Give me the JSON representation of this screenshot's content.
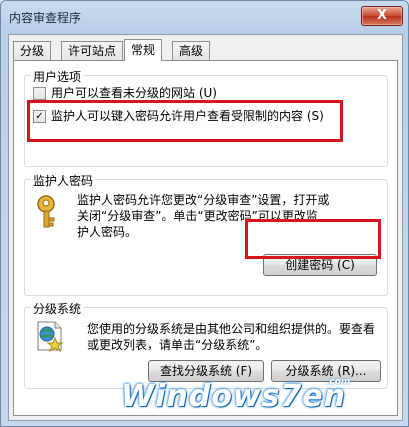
{
  "window": {
    "title": "内容审查程序",
    "close_label": "X"
  },
  "tabs": [
    {
      "label": "分级"
    },
    {
      "label": "许可站点"
    },
    {
      "label": "常规"
    },
    {
      "label": "高级"
    }
  ],
  "user_options": {
    "title": "用户选项",
    "items": [
      {
        "label": "用户可以查看未分级的网站 (U)",
        "checked": false
      },
      {
        "label": "监护人可以键入密码允许用户查看受限制的内容 (S)",
        "checked": true
      }
    ]
  },
  "supervisor_password": {
    "title": "监护人密码",
    "description_lines": [
      "监护人密码允许您更改“分级审查”设置，打开或",
      "关闭“分级审查”。单击“更改密码”可以更改监",
      "护人密码。"
    ],
    "create_button": "创建密码 (C)"
  },
  "rating_systems": {
    "title": "分级系统",
    "description_lines": [
      "您使用的分级系统是由其他公司和组织提供的。要查看",
      "或更改列表，请单击“分级系统”。"
    ],
    "find_button": "查找分级系统 (F)",
    "systems_button": "分级系统 (R)..."
  },
  "watermark": {
    "text": "Windows7en",
    "suffix": ".com"
  },
  "colors": {
    "highlight": "#d8141c",
    "title_bar": "#b9cfe8"
  }
}
